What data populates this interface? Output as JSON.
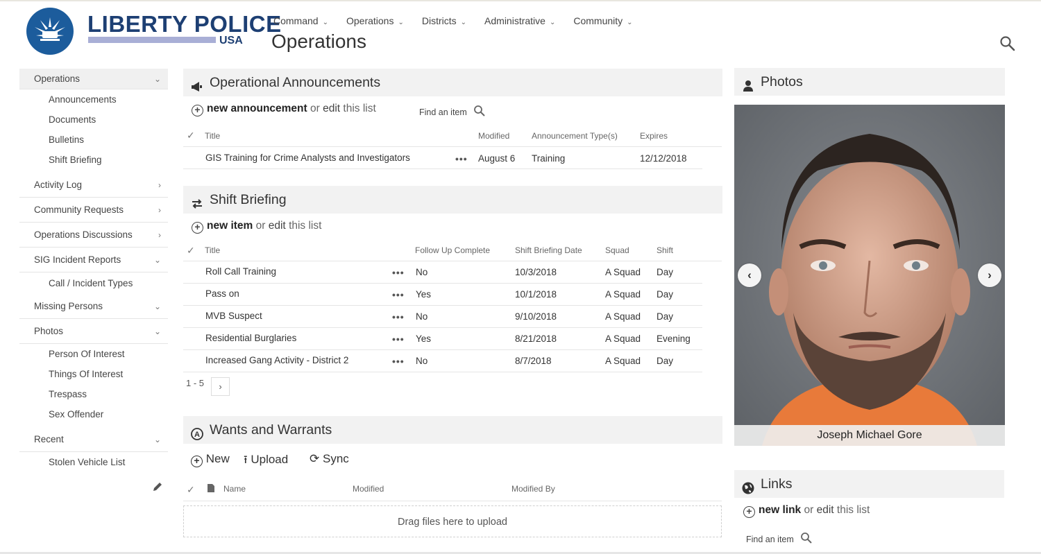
{
  "brand": {
    "name": "LIBERTY POLICE",
    "sub": "USA"
  },
  "topnav": [
    {
      "label": "Command"
    },
    {
      "label": "Operations"
    },
    {
      "label": "Districts"
    },
    {
      "label": "Administrative"
    },
    {
      "label": "Community"
    }
  ],
  "page_title": "Operations",
  "leftnav": {
    "operations": "Operations",
    "operations_items": [
      "Announcements",
      "Documents",
      "Bulletins",
      "Shift Briefing"
    ],
    "activity_log": "Activity Log",
    "community_requests": "Community Requests",
    "operations_discussions": "Operations Discussions",
    "sig_incident_reports": "SIG Incident Reports",
    "sig_items": [
      "Call / Incident Types"
    ],
    "missing_persons": "Missing Persons",
    "photos": "Photos",
    "photos_items": [
      "Person Of Interest",
      "Things Of Interest",
      "Trespass",
      "Sex Offender"
    ],
    "recent": "Recent",
    "recent_items": [
      "Stolen Vehicle List"
    ]
  },
  "announcements": {
    "title": "Operational Announcements",
    "new_label": "new announcement",
    "or": "or",
    "edit": "edit",
    "this_list": "this list",
    "find": "Find an item",
    "columns": [
      "Title",
      "Modified",
      "Announcement Type(s)",
      "Expires"
    ],
    "rows": [
      {
        "title": "GIS Training for Crime Analysts and Investigators",
        "modified": "August 6",
        "type": "Training",
        "expires": "12/12/2018"
      }
    ]
  },
  "shift": {
    "title": "Shift Briefing",
    "new_label": "new item",
    "or": "or",
    "edit": "edit",
    "this_list": "this list",
    "columns": [
      "Title",
      "Follow Up Complete",
      "Shift Briefing Date",
      "Squad",
      "Shift"
    ],
    "rows": [
      {
        "title": "Roll Call Training",
        "follow": "No",
        "date": "10/3/2018",
        "squad": "A Squad",
        "shift": "Day"
      },
      {
        "title": "Pass on",
        "follow": "Yes",
        "date": "10/1/2018",
        "squad": "A Squad",
        "shift": "Day"
      },
      {
        "title": "MVB Suspect",
        "follow": "No",
        "date": "9/10/2018",
        "squad": "A Squad",
        "shift": "Day"
      },
      {
        "title": "Residential Burglaries",
        "follow": "Yes",
        "date": "8/21/2018",
        "squad": "A Squad",
        "shift": "Evening"
      },
      {
        "title": "Increased Gang Activity - District 2",
        "follow": "No",
        "date": "8/7/2018",
        "squad": "A Squad",
        "shift": "Day"
      }
    ],
    "pager": "1 - 5"
  },
  "wants": {
    "title": "Wants and Warrants",
    "new": "New",
    "upload": "Upload",
    "sync": "Sync",
    "columns": [
      "Name",
      "Modified",
      "Modified By"
    ],
    "dropzone": "Drag files here to upload"
  },
  "photos": {
    "title": "Photos",
    "caption": "Joseph Michael Gore"
  },
  "links": {
    "title": "Links",
    "new_label": "new link",
    "or": "or",
    "edit": "edit",
    "this_list": "this list",
    "find": "Find an item"
  },
  "colors": {
    "brand_blue": "#1d3f73",
    "logo_blue": "#1c5c9c",
    "brand_bar": "#a9afd6",
    "section_bg": "#f2f2f2"
  }
}
